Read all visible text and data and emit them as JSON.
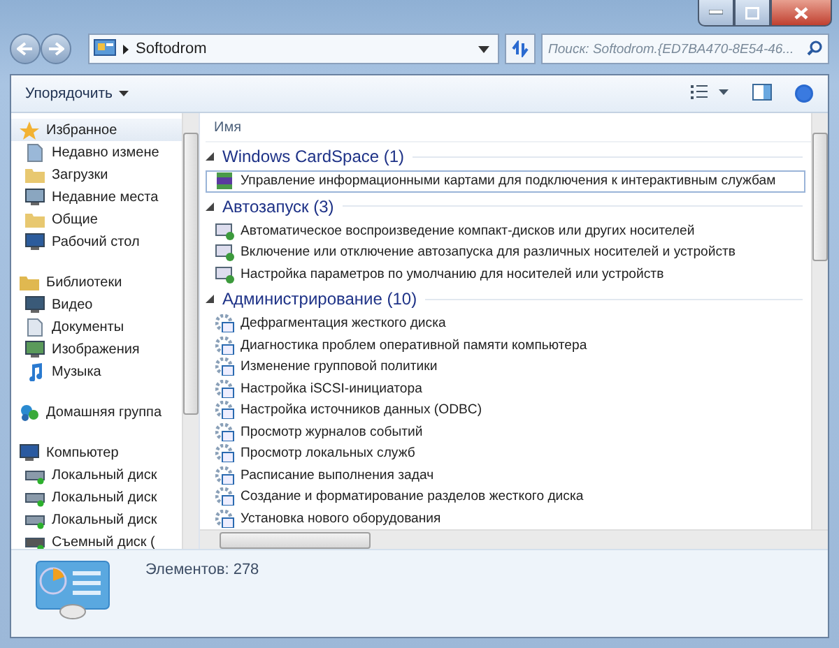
{
  "address": {
    "path": "Softodrom"
  },
  "search": {
    "placeholder": "Поиск: Softodrom.{ED7BA470-8E54-46..."
  },
  "toolbar": {
    "organize": "Упорядочить"
  },
  "sidebar": {
    "groups": [
      {
        "label": "Избранное",
        "kind": "star",
        "selected": true,
        "items": [
          {
            "label": "Недавно измене",
            "kind": "recent"
          },
          {
            "label": "Загрузки",
            "kind": "download"
          },
          {
            "label": "Недавние места",
            "kind": "places"
          },
          {
            "label": "Общие",
            "kind": "folder"
          },
          {
            "label": "Рабочий стол",
            "kind": "desktop"
          }
        ]
      },
      {
        "label": "Библиотеки",
        "kind": "library",
        "selected": false,
        "items": [
          {
            "label": "Видео",
            "kind": "video"
          },
          {
            "label": "Документы",
            "kind": "doc"
          },
          {
            "label": "Изображения",
            "kind": "image"
          },
          {
            "label": "Музыка",
            "kind": "music"
          }
        ]
      },
      {
        "label": "Домашняя группа",
        "kind": "homegroup",
        "selected": false
      },
      {
        "label": "Компьютер",
        "kind": "computer",
        "selected": false,
        "items": [
          {
            "label": "Локальный диск",
            "kind": "disk"
          },
          {
            "label": "Локальный диск",
            "kind": "disk"
          },
          {
            "label": "Локальный диск",
            "kind": "disk"
          },
          {
            "label": "Съемный диск (",
            "kind": "removable"
          }
        ]
      }
    ]
  },
  "content": {
    "column": "Имя",
    "groups": [
      {
        "title": "Windows CardSpace (1)",
        "expanded": true,
        "kind": "card",
        "items": [
          {
            "label": "Управление информационными картами для подключения к интерактивным службам",
            "selected": true
          }
        ]
      },
      {
        "title": "Автозапуск (3)",
        "expanded": true,
        "kind": "autoplay",
        "items": [
          {
            "label": "Автоматическое воспроизведение компакт-дисков или других носителей",
            "selected": false
          },
          {
            "label": "Включение или отключение автозапуска для различных носителей и устройств",
            "selected": false
          },
          {
            "label": "Настройка параметров по умолчанию для носителей или устройств",
            "selected": false
          }
        ]
      },
      {
        "title": "Администрирование (10)",
        "expanded": true,
        "kind": "admin",
        "items": [
          {
            "label": "Дефрагментация жесткого диска",
            "selected": false
          },
          {
            "label": "Диагностика проблем оперативной памяти компьютера",
            "selected": false
          },
          {
            "label": "Изменение групповой политики",
            "selected": false
          },
          {
            "label": "Настройка iSCSI-инициатора",
            "selected": false
          },
          {
            "label": "Настройка источников данных (ODBC)",
            "selected": false
          },
          {
            "label": "Просмотр журналов событий",
            "selected": false
          },
          {
            "label": "Просмотр локальных служб",
            "selected": false
          },
          {
            "label": "Расписание выполнения задач",
            "selected": false
          },
          {
            "label": "Создание и форматирование разделов жесткого диска",
            "selected": false
          },
          {
            "label": "Установка нового оборудования",
            "selected": false
          }
        ]
      }
    ]
  },
  "details": {
    "count": "Элементов: 278"
  }
}
